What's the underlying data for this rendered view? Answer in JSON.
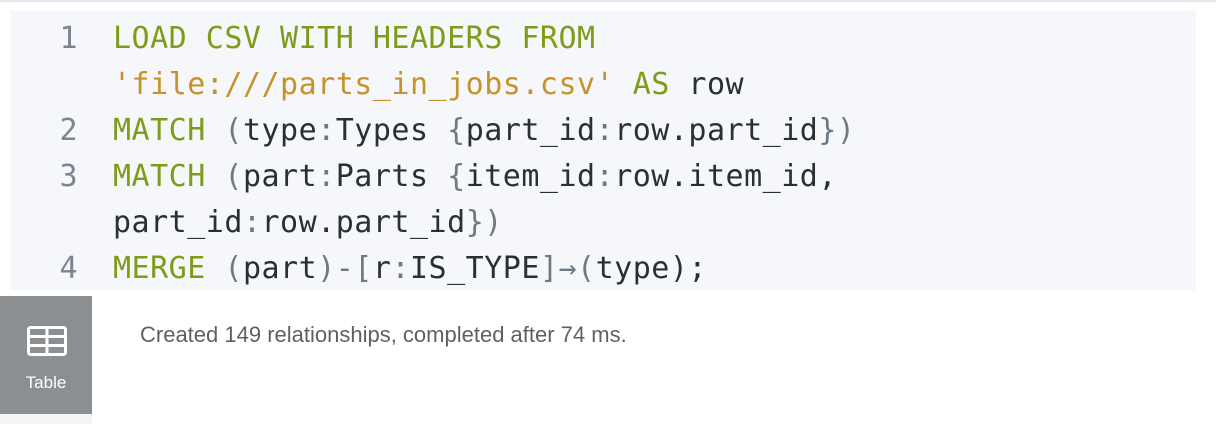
{
  "editor": {
    "lines": [
      {
        "number": "1",
        "tokens": [
          {
            "text": "LOAD CSV WITH HEADERS FROM",
            "type": "kw"
          }
        ]
      },
      {
        "number": "",
        "tokens": [
          {
            "text": "'file:///parts_in_jobs.csv'",
            "type": "str"
          },
          {
            "text": " ",
            "type": "plain"
          },
          {
            "text": "AS",
            "type": "kw"
          },
          {
            "text": " row",
            "type": "plain"
          }
        ]
      },
      {
        "number": "2",
        "tokens": [
          {
            "text": "MATCH",
            "type": "kw"
          },
          {
            "text": " (",
            "type": "punct"
          },
          {
            "text": "type",
            "type": "plain"
          },
          {
            "text": ":",
            "type": "punct"
          },
          {
            "text": "Types",
            "type": "plain"
          },
          {
            "text": " {",
            "type": "punct"
          },
          {
            "text": "part_id",
            "type": "plain"
          },
          {
            "text": ":",
            "type": "punct"
          },
          {
            "text": "row.part_id",
            "type": "plain"
          },
          {
            "text": "})",
            "type": "punct"
          }
        ]
      },
      {
        "number": "3",
        "tokens": [
          {
            "text": "MATCH",
            "type": "kw"
          },
          {
            "text": " (",
            "type": "punct"
          },
          {
            "text": "part",
            "type": "plain"
          },
          {
            "text": ":",
            "type": "punct"
          },
          {
            "text": "Parts",
            "type": "plain"
          },
          {
            "text": " {",
            "type": "punct"
          },
          {
            "text": "item_id",
            "type": "plain"
          },
          {
            "text": ":",
            "type": "punct"
          },
          {
            "text": "row.item_id,",
            "type": "plain"
          }
        ]
      },
      {
        "number": "",
        "tokens": [
          {
            "text": "part_id",
            "type": "plain"
          },
          {
            "text": ":",
            "type": "punct"
          },
          {
            "text": "row.part_id",
            "type": "plain"
          },
          {
            "text": "})",
            "type": "punct"
          }
        ]
      },
      {
        "number": "4",
        "tokens": [
          {
            "text": "MERGE",
            "type": "kw"
          },
          {
            "text": " (",
            "type": "punct"
          },
          {
            "text": "part",
            "type": "plain"
          },
          {
            "text": ")-[",
            "type": "punct"
          },
          {
            "text": "r",
            "type": "plain"
          },
          {
            "text": ":",
            "type": "punct"
          },
          {
            "text": "IS_TYPE",
            "type": "plain"
          },
          {
            "text": "]→(",
            "type": "punct"
          },
          {
            "text": "type",
            "type": "plain"
          },
          {
            "text": ");",
            "type": "plain"
          }
        ]
      }
    ]
  },
  "sidebar": {
    "tab_label": "Table",
    "tab_icon": "table-icon"
  },
  "result": {
    "message": "Created 149 relationships, completed after 74 ms."
  },
  "colors": {
    "keyword": "#7e9b1a",
    "string": "#c7922a",
    "text": "#2a2f35",
    "punctuation": "#6c7a85",
    "editor_bg": "#f5f7fa",
    "tab_bg": "#8c8f92"
  }
}
